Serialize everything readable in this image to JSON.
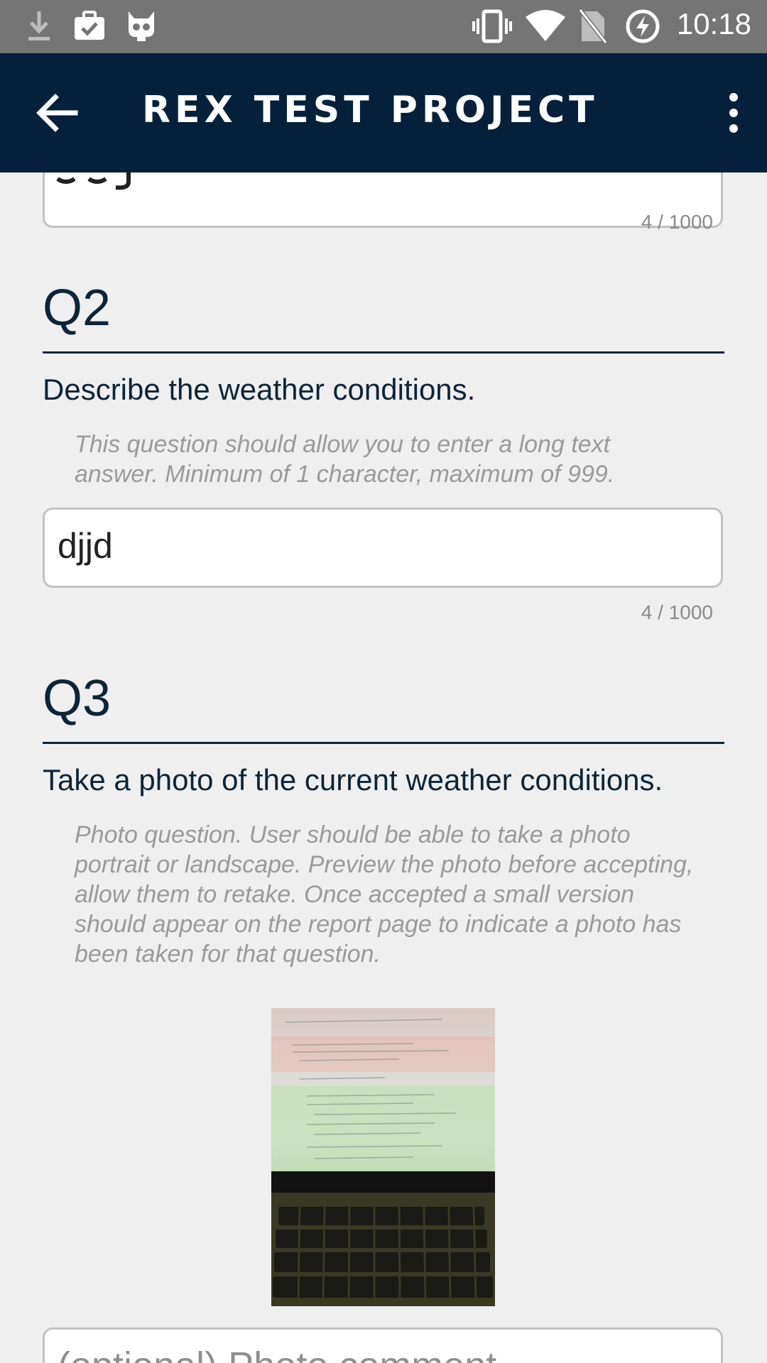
{
  "status_bar": {
    "time": "10:18",
    "icons": [
      "download-icon",
      "briefcase-check-icon",
      "cyanogen-mod-icon",
      "vibrate-icon",
      "wifi-icon",
      "no-sim-icon",
      "battery-charging-icon"
    ]
  },
  "app_bar": {
    "title": "REX TEST PROJECT",
    "icons": [
      "back-arrow-icon",
      "more-vertical-icon"
    ]
  },
  "q1": {
    "counter": "4 / 1000"
  },
  "q2": {
    "number": "Q2",
    "question": "Describe the weather conditions.",
    "hint": "This question should allow you to enter a long text answer. Minimum of 1 character, maximum of 999.",
    "answer": "djjd",
    "counter": "4 / 1000"
  },
  "q3": {
    "number": "Q3",
    "question": "Take a photo of the current weather conditions.",
    "hint": "Photo question.  User should be able to take a photo portrait or landscape.  Preview the photo before accepting, allow them to retake.  Once accepted a small version should appear on the report page to indicate a photo has been taken for that question.",
    "comment_placeholder": "(optional) Photo comment"
  },
  "colors": {
    "app_bar": "#04203a",
    "status_bar": "#757575",
    "background": "#efefef",
    "text_primary": "#0b2538",
    "hint": "#9a9a9a"
  }
}
